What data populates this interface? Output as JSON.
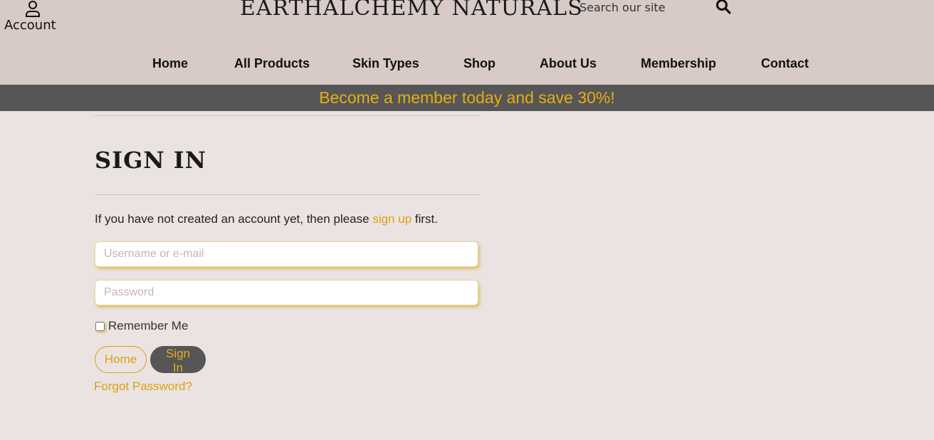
{
  "header": {
    "account_label": "Account",
    "brand": "EarthAlchemy Naturals",
    "search_placeholder": "Search our site"
  },
  "nav": {
    "items": [
      {
        "label": "Home"
      },
      {
        "label": "All Products"
      },
      {
        "label": "Skin Types"
      },
      {
        "label": "Shop"
      },
      {
        "label": "About Us"
      },
      {
        "label": "Membership"
      },
      {
        "label": "Contact"
      }
    ]
  },
  "promo": "Become a member today and save 30%!",
  "signin": {
    "title": "Sign In",
    "intro_before": "If you have not created an account yet, then please ",
    "intro_link": "sign up",
    "intro_after": " first.",
    "username_placeholder": "Username or e-mail",
    "password_placeholder": "Password",
    "remember_label": "Remember Me",
    "home_button": "Home",
    "signin_button": "Sign In",
    "forgot_link": "Forgot Password?"
  },
  "colors": {
    "header_bg": "#d7cac7",
    "page_bg": "#ebe3e2",
    "promo_bg": "#565656",
    "accent": "#d8a20f"
  },
  "icons": {
    "account": "person-icon",
    "search": "magnifier-icon"
  }
}
